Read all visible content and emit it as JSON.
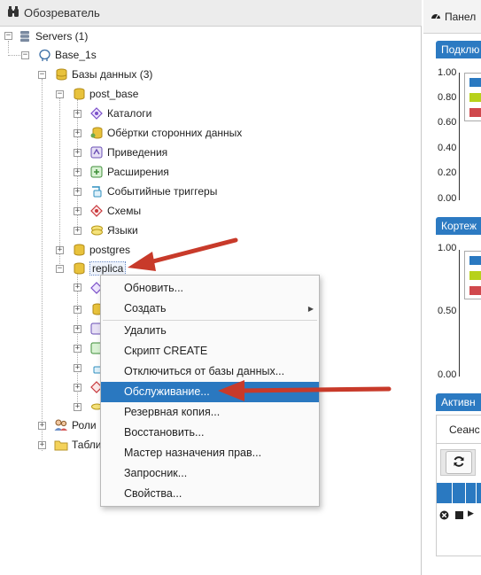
{
  "browser": {
    "title": "Обозреватель",
    "tree": {
      "servers": "Servers (1)",
      "server": "Base_1s",
      "databases": "Базы данных (3)",
      "db1": "post_base",
      "db1_children": [
        "Каталоги",
        "Обёртки сторонних данных",
        "Приведения",
        "Расширения",
        "Событийные триггеры",
        "Схемы",
        "Языки"
      ],
      "db2": "postgres",
      "db3": "replica",
      "roles": "Роли",
      "tablespaces": "Табли"
    }
  },
  "dashboard": {
    "tab_label": "Панел",
    "panels": [
      {
        "title": "Подклю",
        "ticks": [
          "1.00",
          "0.80",
          "0.60",
          "0.40",
          "0.20",
          "0.00"
        ]
      },
      {
        "title": "Кортеж",
        "ticks": [
          "1.00",
          "0.50",
          "0.00"
        ]
      },
      {
        "title": "Активн"
      }
    ],
    "activity_tab": "Сеанс",
    "legend_colors": [
      "#2a79c1",
      "#b7d11b",
      "#d0484c"
    ]
  },
  "context_menu": {
    "items": [
      "Обновить...",
      "Создать",
      "Удалить",
      "Скрипт CREATE",
      "Отключиться от базы данных...",
      "Обслуживание...",
      "Резервная копия...",
      "Восстановить...",
      "Мастер назначения прав...",
      "Запросник...",
      "Свойства..."
    ],
    "highlighted": "Обслуживание..."
  },
  "colors": {
    "accent": "#2a78c0",
    "arrow": "#c83a2a"
  }
}
